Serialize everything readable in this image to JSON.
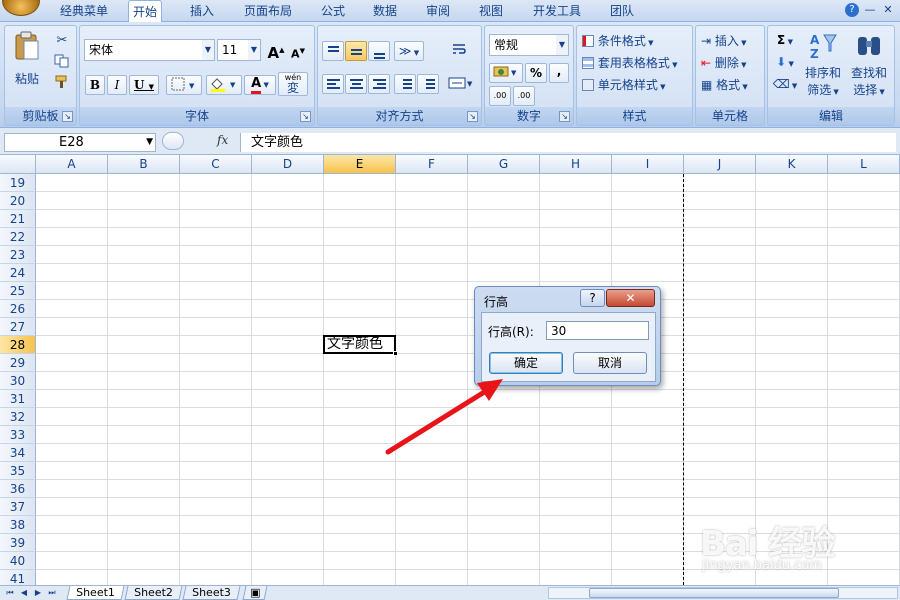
{
  "ribbon_tabs": [
    "经典菜单",
    "开始",
    "插入",
    "页面布局",
    "公式",
    "数据",
    "审阅",
    "视图",
    "开发工具",
    "团队"
  ],
  "active_tab": "开始",
  "groups": {
    "clipboard": {
      "label": "剪贴板",
      "paste": "粘贴"
    },
    "font": {
      "label": "字体",
      "font_name": "宋体",
      "font_size": "11",
      "bold": "B",
      "italic": "I",
      "underline": "U",
      "grow": "A",
      "shrink": "A",
      "color_letter": "A",
      "phonetic": "wén"
    },
    "alignment": {
      "label": "对齐方式"
    },
    "number": {
      "label": "数字",
      "format": "常规",
      "percent": "%",
      "comma": ",",
      "inc_decimal": ".00",
      "dec_decimal": ".00"
    },
    "styles": {
      "label": "样式",
      "conditional": "条件格式",
      "table": "套用表格格式",
      "cell": "单元格样式"
    },
    "cells": {
      "label": "单元格",
      "insert": "插入",
      "delete": "删除",
      "format": "格式"
    },
    "editing": {
      "label": "编辑",
      "sort": "排序和",
      "sort2": "筛选",
      "find": "查找和",
      "find2": "选择",
      "sum": "Σ"
    }
  },
  "formula_bar": {
    "name_box": "E28",
    "fx": "fx",
    "content": "文字颜色"
  },
  "columns": [
    "A",
    "B",
    "C",
    "D",
    "E",
    "F",
    "G",
    "H",
    "I",
    "J",
    "K",
    "L"
  ],
  "active_column": "E",
  "rows": [
    "19",
    "20",
    "21",
    "22",
    "23",
    "24",
    "25",
    "26",
    "27",
    "28",
    "29",
    "30",
    "31",
    "32",
    "33",
    "34",
    "35",
    "36",
    "37",
    "38",
    "39",
    "40",
    "41"
  ],
  "active_row": "28",
  "active_cell_text": "文字颜色",
  "dialog": {
    "title": "行高",
    "help": "?",
    "close": "✕",
    "label": "行高(R):",
    "value": "30",
    "ok": "确定",
    "cancel": "取消"
  },
  "sheets": [
    "Sheet1",
    "Sheet2",
    "Sheet3"
  ],
  "active_sheet": "Sheet1",
  "watermark": {
    "main": "Bai 经验",
    "sub": "jingyan.baidu.com"
  },
  "colors": {
    "arrow": "#e8141a",
    "accent": "#15428b"
  }
}
